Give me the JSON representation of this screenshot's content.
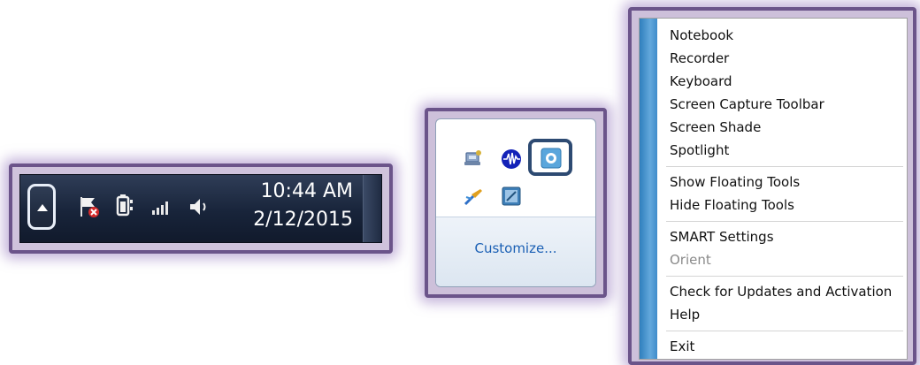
{
  "taskbar": {
    "clock_time": "10:44 AM",
    "clock_date": "2/12/2015",
    "icons": [
      "flag-error-icon",
      "power-plug-icon",
      "signal-bars-icon",
      "speaker-icon"
    ]
  },
  "flyout": {
    "icons": [
      "network-icon",
      "audio-wave-icon",
      "smart-board-icon",
      "pen-tool-icon",
      "app-window-icon"
    ],
    "customize_label": "Customize..."
  },
  "menu": {
    "items": [
      {
        "label": "Notebook"
      },
      {
        "label": "Recorder"
      },
      {
        "label": "Keyboard"
      },
      {
        "label": "Screen Capture Toolbar"
      },
      {
        "label": "Screen Shade"
      },
      {
        "label": "Spotlight"
      },
      {
        "label": "Show Floating Tools"
      },
      {
        "label": "Hide Floating Tools"
      },
      {
        "label": "SMART Settings"
      },
      {
        "label": "Orient",
        "disabled": true
      },
      {
        "label": "Check for Updates and Activation"
      },
      {
        "label": "Help"
      },
      {
        "label": "Exit"
      }
    ]
  },
  "colors": {
    "frame_border": "#6b548a",
    "frame_glow": "#9678be",
    "taskbar": "#1b2740",
    "link": "#1a5fb4",
    "menu_stripe": "#3f8ccb",
    "highlight_box": "#2d4a72"
  }
}
